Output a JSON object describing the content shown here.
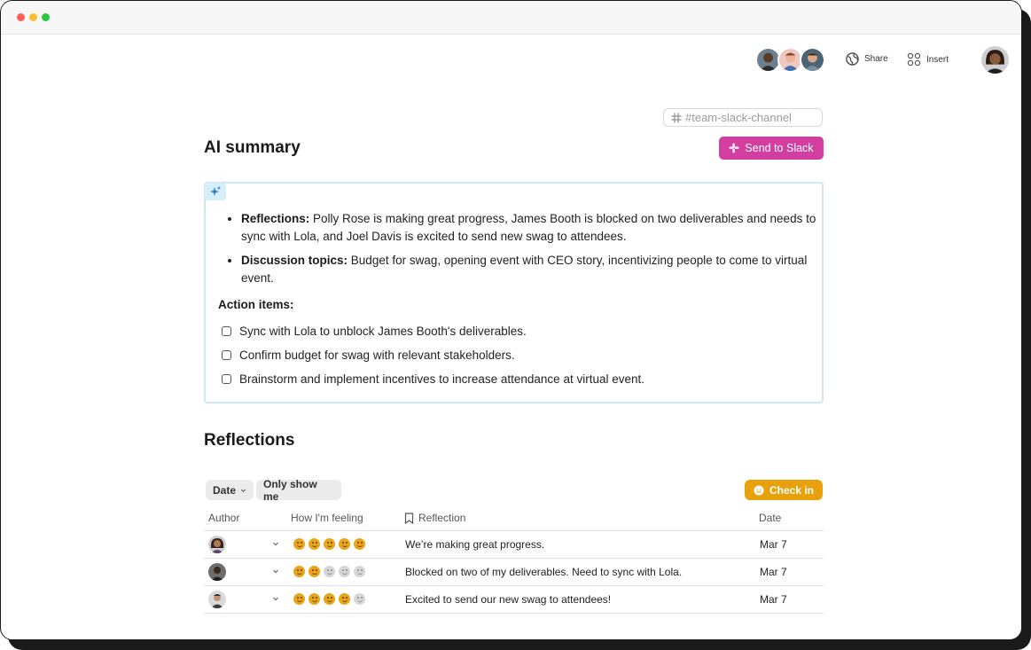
{
  "window": {
    "traffic_lights": [
      "#ff5f57",
      "#febc2e",
      "#28c840"
    ]
  },
  "header": {
    "share_label": "Share",
    "insert_label": "Insert"
  },
  "channel_input": {
    "placeholder": "#team-slack-channel"
  },
  "ai_summary": {
    "title": "AI summary",
    "send_button": "Send to Slack",
    "bullets": [
      {
        "label": "Reflections:",
        "text": "Polly Rose is making great progress, James Booth is blocked on two deliverables and needs to sync with Lola, and Joel Davis is excited to send new swag to attendees."
      },
      {
        "label": "Discussion topics:",
        "text": "Budget for swag, opening event with CEO story, incentivizing people to come to virtual event."
      }
    ],
    "action_items_title": "Action items:",
    "action_items": [
      "Sync with Lola to unblock James Booth's deliverables.",
      "Confirm budget for swag with relevant stakeholders.",
      "Brainstorm and implement incentives to increase attendance at virtual event."
    ]
  },
  "reflections": {
    "title": "Reflections",
    "filters": {
      "date": "Date",
      "only_me": "Only show me"
    },
    "checkin_button": "Check in",
    "columns": {
      "author": "Author",
      "feeling": "How I'm feeling",
      "reflection": "Reflection",
      "date": "Date"
    },
    "rows": [
      {
        "feeling": 5,
        "reflection": "We’re making great progress.",
        "date": "Mar 7"
      },
      {
        "feeling": 2,
        "reflection": "Blocked on two of my deliverables. Need to sync with Lola.",
        "date": "Mar 7"
      },
      {
        "feeling": 4,
        "reflection": "Excited to send our new swag to attendees!",
        "date": "Mar 7"
      }
    ]
  },
  "colors": {
    "slack_button": "#d23fa0",
    "checkin_button": "#e8a10c",
    "summary_border": "#cfe8f7",
    "feeling_on": "#eba415",
    "feeling_off": "#d6d6d6"
  },
  "icons": {
    "slack": "slack-icon",
    "share": "globe-icon",
    "insert": "insert-grid-icon",
    "sparkle": "sparkle-icon",
    "hash": "slack-hash-icon",
    "bookmark": "bookmark-icon",
    "chevron": "chevron-down-icon",
    "checkin": "smiley-icon"
  }
}
